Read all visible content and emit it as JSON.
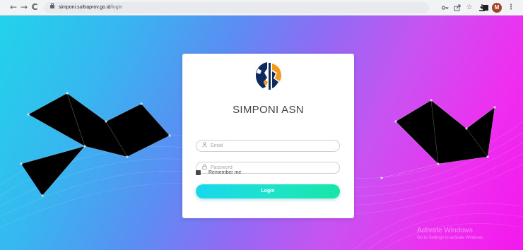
{
  "browser": {
    "back_icon": "←",
    "forward_icon": "→",
    "reload_icon": "C",
    "url_domain": "simponi.sultraprov.go.id",
    "url_path": "/login",
    "icons": [
      "key-icon",
      "share-icon",
      "star-icon",
      "download-icon",
      "sidebar-icon"
    ],
    "avatar_letter": "M",
    "menu_icon": "⋮"
  },
  "login": {
    "app_title": "SIMPONI ASN",
    "email_placeholder": "Email",
    "password_placeholder": "Password",
    "remember_label": "Remember me",
    "login_button": "Login"
  },
  "watermark": {
    "line1": "Activate Windows",
    "line2": "Go to Settings to activate Windows."
  },
  "colors": {
    "gradient_start": "#22d3ea",
    "gradient_end": "#f418ee",
    "button_start": "#19d7ee",
    "button_end": "#16e6a7",
    "logo_navy": "#0f2a5c",
    "logo_orange": "#f39a1b"
  }
}
